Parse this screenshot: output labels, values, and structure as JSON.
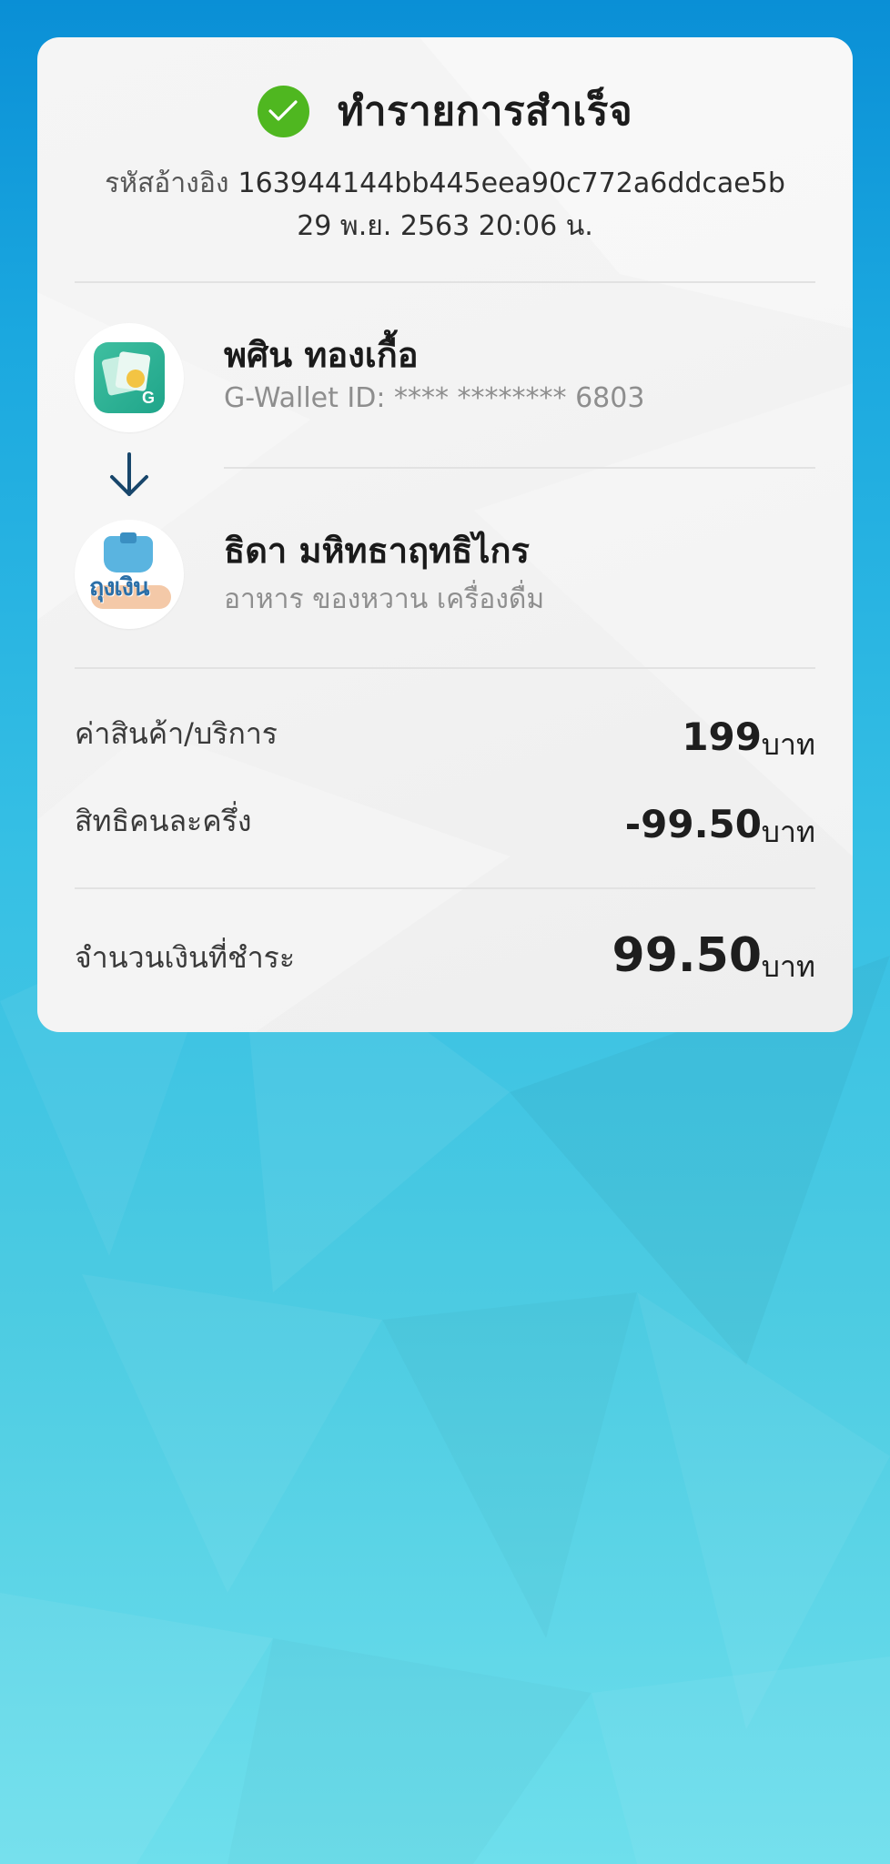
{
  "status": {
    "title": "ทำรายการสำเร็จ",
    "icon": "check-circle-icon",
    "color": "#4fb720"
  },
  "reference": {
    "label": "รหัสอ้างอิง",
    "value": "163944144bb445eea90c772a6ddcae5b"
  },
  "datetime": "29 พ.ย. 2563 20:06 น.",
  "sender": {
    "name": "พศิน ทองเกื้อ",
    "wallet_id": "G-Wallet ID: **** ******** 6803",
    "icon": "g-wallet-icon"
  },
  "transfer_arrow_icon": "arrow-down-icon",
  "recipient": {
    "name": "ธิดา มหิทธาฤทธิไกร",
    "category": "อาหาร ของหวาน เครื่องดื่ม",
    "icon": "tung-ngern-icon",
    "logo_text": "ถุงเงิน"
  },
  "summary": {
    "goods": {
      "label": "ค่าสินค้า/บริการ",
      "value": "199",
      "unit": "บาท"
    },
    "discount": {
      "label": "สิทธิคนละครึ่ง",
      "value": "-99.50",
      "unit": "บาท"
    },
    "total": {
      "label": "จำนวนเงินที่ชำระ",
      "value": "99.50",
      "unit": "บาท"
    }
  }
}
